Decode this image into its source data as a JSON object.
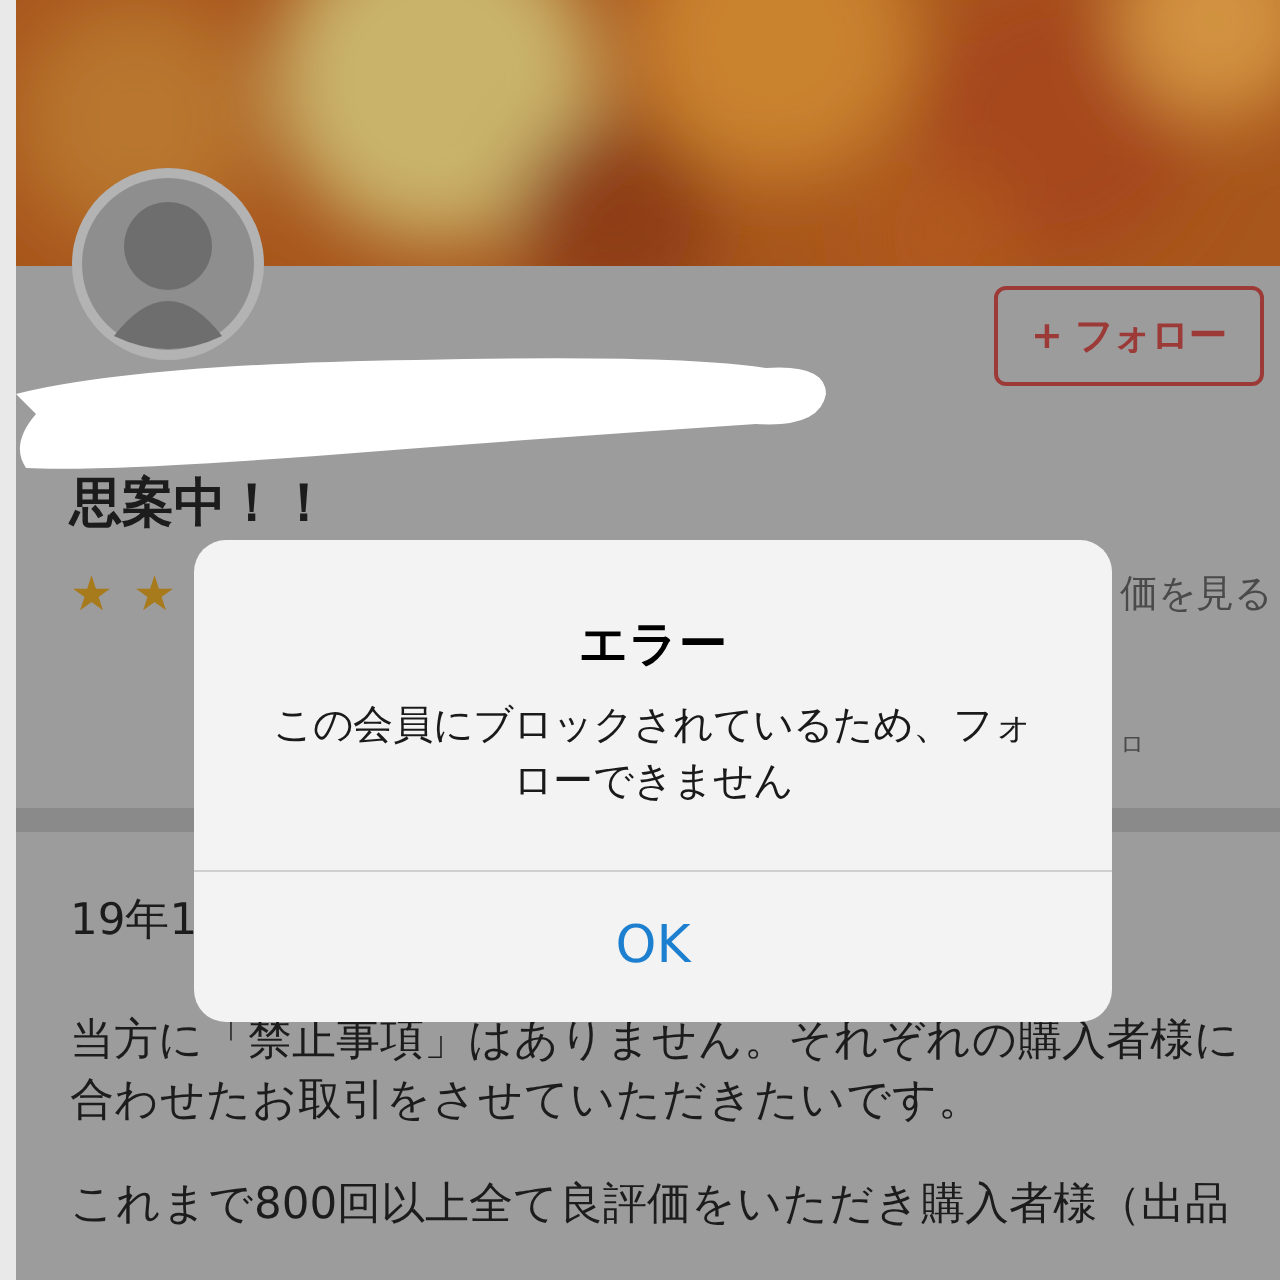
{
  "profile": {
    "follow_button": {
      "icon": "+",
      "label": "フォロー"
    },
    "bio_title": "思案中！！",
    "rating_marks": [
      "★",
      "★"
    ],
    "reviews_link": "価を見る",
    "side_text": "ロ"
  },
  "post": {
    "date": "19年1",
    "paragraphs": [
      "当方に「禁止事項」はありません。それぞれの購入者様に合わせたお取引をさせていただきたいです。",
      "これまで800回以上全て良評価をいただき購入者様（出品"
    ]
  },
  "alert": {
    "title": "エラー",
    "message": "この会員にブロックされているため、フォローできません",
    "buttons": [
      "OK"
    ]
  }
}
